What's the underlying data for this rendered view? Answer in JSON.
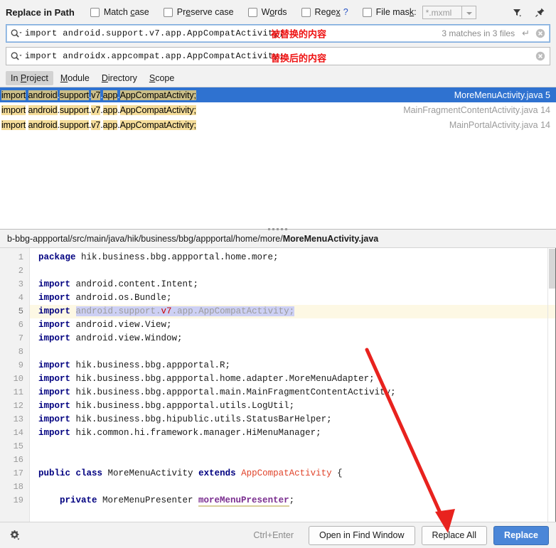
{
  "header": {
    "title": "Replace in Path",
    "checkboxes": [
      {
        "label_pre": "Match ",
        "label_u": "c",
        "label_post": "ase",
        "checked": false,
        "name": "match-case"
      },
      {
        "label_pre": "Pr",
        "label_u": "e",
        "label_post": "serve case",
        "checked": false,
        "name": "preserve-case"
      },
      {
        "label_pre": "W",
        "label_u": "o",
        "label_post": "rds",
        "checked": false,
        "name": "words"
      },
      {
        "label_pre": "Rege",
        "label_u": "x",
        "label_post": "",
        "checked": false,
        "name": "regex",
        "help": "?"
      },
      {
        "label_pre": "File mas",
        "label_u": "k",
        "label_post": ":",
        "checked": false,
        "name": "file-mask"
      }
    ],
    "file_mask_value": "*.mxml",
    "filter_icon": "filter-icon",
    "pin_icon": "pin-icon"
  },
  "search": {
    "query_value": "import android.support.v7.app.AppCompatActivity;",
    "query_annotation": "被替换的内容",
    "match_info": "3 matches in 3 files",
    "enter_glyph": "↵",
    "replace_value": "import androidx.appcompat.app.AppCompatActivity;",
    "replace_annotation": "替换后的内容"
  },
  "scope_tabs": [
    {
      "pre": "In ",
      "u": "P",
      "post": "roject",
      "active": true
    },
    {
      "pre": "",
      "u": "M",
      "post": "odule",
      "active": false
    },
    {
      "pre": "",
      "u": "D",
      "post": "irectory",
      "active": false
    },
    {
      "pre": "",
      "u": "S",
      "post": "cope",
      "active": false
    }
  ],
  "results": [
    {
      "selected": true,
      "segments": [
        {
          "t": "import",
          "hl": true
        },
        {
          "t": " ",
          "hl": false
        },
        {
          "t": "android",
          "hl": true
        },
        {
          "t": ".",
          "hl": false
        },
        {
          "t": "support",
          "hl": true
        },
        {
          "t": ".",
          "hl": false
        },
        {
          "t": "v7",
          "hl": true
        },
        {
          "t": ".",
          "hl": false
        },
        {
          "t": "app",
          "hl": true
        },
        {
          "t": ".",
          "hl": false
        },
        {
          "t": "AppCompatActivity;",
          "hl": true
        }
      ],
      "text": "import android.support.v7.app.AppCompatActivity;",
      "file": "MoreMenuActivity.java 5"
    },
    {
      "selected": false,
      "segments": [
        {
          "t": "import",
          "hl": true
        },
        {
          "t": " ",
          "hl": false
        },
        {
          "t": "android",
          "hl": true
        },
        {
          "t": ".",
          "hl": false
        },
        {
          "t": "support",
          "hl": true
        },
        {
          "t": ".",
          "hl": false
        },
        {
          "t": "v7",
          "hl": true
        },
        {
          "t": ".",
          "hl": false
        },
        {
          "t": "app",
          "hl": true
        },
        {
          "t": ".",
          "hl": false
        },
        {
          "t": "AppCompatActivity;",
          "hl": true
        }
      ],
      "text": "import android.support.v7.app.AppCompatActivity;",
      "file": "MainFragmentContentActivity.java 14"
    },
    {
      "selected": false,
      "segments": [
        {
          "t": "import",
          "hl": true
        },
        {
          "t": " ",
          "hl": false
        },
        {
          "t": "android",
          "hl": true
        },
        {
          "t": ".",
          "hl": false
        },
        {
          "t": "support",
          "hl": true
        },
        {
          "t": ".",
          "hl": false
        },
        {
          "t": "v7",
          "hl": true
        },
        {
          "t": ".",
          "hl": false
        },
        {
          "t": "app",
          "hl": true
        },
        {
          "t": ".",
          "hl": false
        },
        {
          "t": "AppCompatActivity;",
          "hl": true
        }
      ],
      "text": "import android.support.v7.app.AppCompatActivity;",
      "file": "MainPortalActivity.java 14"
    }
  ],
  "path_bar": {
    "prefix": "b-bbg-appportal/src/main/java/hik/business/bbg/appportal/home/more/",
    "filename": "MoreMenuActivity.java"
  },
  "code": {
    "line_numbers": [
      "1",
      "2",
      "3",
      "4",
      "5",
      "6",
      "7",
      "8",
      "9",
      "10",
      "11",
      "12",
      "13",
      "14",
      "15",
      "16",
      "17",
      "18",
      "19"
    ],
    "current_line": 5,
    "lines": [
      {
        "n": 1,
        "parts": [
          {
            "t": "package ",
            "c": "kw"
          },
          {
            "t": "hik.business.bbg.appportal.home.more;",
            "c": "plain"
          }
        ]
      },
      {
        "n": 2,
        "parts": []
      },
      {
        "n": 3,
        "parts": [
          {
            "t": "import ",
            "c": "kw"
          },
          {
            "t": "android.content.Intent;",
            "c": "plain"
          }
        ]
      },
      {
        "n": 4,
        "parts": [
          {
            "t": "import ",
            "c": "kw"
          },
          {
            "t": "android.os.Bundle;",
            "c": "plain"
          }
        ]
      },
      {
        "n": 5,
        "parts": [
          {
            "t": "import ",
            "c": "kw"
          },
          {
            "t": "android.support.",
            "c": "muted"
          },
          {
            "t": "v7",
            "c": "red"
          },
          {
            "t": ".app.AppCompatActivity;",
            "c": "muted"
          }
        ]
      },
      {
        "n": 6,
        "parts": [
          {
            "t": "import ",
            "c": "kw"
          },
          {
            "t": "android.view.View;",
            "c": "plain"
          }
        ]
      },
      {
        "n": 7,
        "parts": [
          {
            "t": "import ",
            "c": "kw"
          },
          {
            "t": "android.view.Window;",
            "c": "plain"
          }
        ]
      },
      {
        "n": 8,
        "parts": []
      },
      {
        "n": 9,
        "parts": [
          {
            "t": "import ",
            "c": "kw"
          },
          {
            "t": "hik.business.bbg.appportal.R;",
            "c": "plain"
          }
        ]
      },
      {
        "n": 10,
        "parts": [
          {
            "t": "import ",
            "c": "kw"
          },
          {
            "t": "hik.business.bbg.appportal.home.adapter.MoreMenuAdapter;",
            "c": "plain"
          }
        ]
      },
      {
        "n": 11,
        "parts": [
          {
            "t": "import ",
            "c": "kw"
          },
          {
            "t": "hik.business.bbg.appportal.main.MainFragmentContentActivity;",
            "c": "plain"
          }
        ]
      },
      {
        "n": 12,
        "parts": [
          {
            "t": "import ",
            "c": "kw"
          },
          {
            "t": "hik.business.bbg.appportal.utils.LogUtil;",
            "c": "plain"
          }
        ]
      },
      {
        "n": 13,
        "parts": [
          {
            "t": "import ",
            "c": "kw"
          },
          {
            "t": "hik.business.bbg.hipublic.utils.StatusBarHelper;",
            "c": "plain"
          }
        ]
      },
      {
        "n": 14,
        "parts": [
          {
            "t": "import ",
            "c": "kw"
          },
          {
            "t": "hik.common.hi.framework.manager.HiMenuManager;",
            "c": "plain"
          }
        ]
      },
      {
        "n": 15,
        "parts": []
      },
      {
        "n": 16,
        "parts": []
      },
      {
        "n": 17,
        "parts": [
          {
            "t": "public class ",
            "c": "kw"
          },
          {
            "t": "MoreMenuActivity ",
            "c": "plain"
          },
          {
            "t": "extends ",
            "c": "kw"
          },
          {
            "t": "AppCompatActivity",
            "c": "type-red"
          },
          {
            "t": " {",
            "c": "plain"
          }
        ]
      },
      {
        "n": 18,
        "parts": []
      },
      {
        "n": 19,
        "parts": [
          {
            "t": "    private ",
            "c": "kw"
          },
          {
            "t": "MoreMenuPresenter ",
            "c": "plain"
          },
          {
            "t": "moreMenuPresenter",
            "c": "field-var"
          },
          {
            "t": ";",
            "c": "plain"
          }
        ]
      }
    ]
  },
  "bottom": {
    "gear_icon": "gear-icon",
    "shortcut": "Ctrl+Enter",
    "open_in_find_window": "Open in Find Window",
    "replace_all": "Replace All",
    "replace": "Replace"
  },
  "colors": {
    "accent": "#2f72d0",
    "primary_button": "#4a86d8",
    "highlight": "#f5dd9a",
    "annotation_red": "#ee1111",
    "current_line": "#fdf8e4"
  }
}
